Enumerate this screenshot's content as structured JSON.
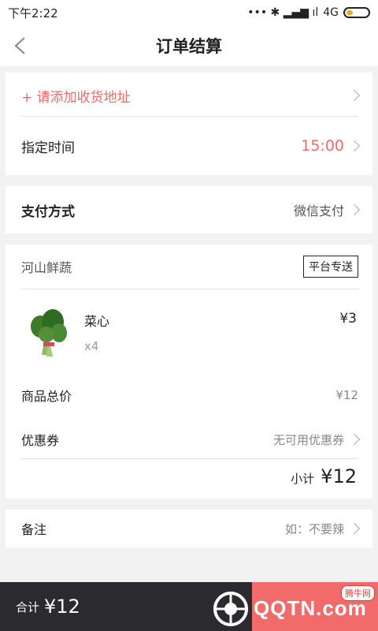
{
  "status_bar": {
    "time": "下午2:22",
    "signal_info": "... ✱ ᴴᴰ ıl ıl 4G",
    "network": "4G"
  },
  "nav": {
    "title": "订单结算"
  },
  "address": {
    "label": "+ 请添加收货地址"
  },
  "time_row": {
    "label": "指定时间",
    "value": "15:00"
  },
  "payment": {
    "label": "支付方式",
    "value": "微信支付"
  },
  "shop": {
    "name": "河山鲜蔬",
    "tag": "平台专送"
  },
  "product": {
    "name": "菜心",
    "qty": "x4",
    "price": "¥3"
  },
  "goods_total": {
    "label": "商品总价",
    "value": "¥12"
  },
  "coupon": {
    "label": "优惠券",
    "value": "无可用优惠券"
  },
  "subtotal": {
    "label": "小计",
    "amount": "¥12"
  },
  "remark": {
    "label": "备注",
    "placeholder": "如：不要辣"
  },
  "footer": {
    "total_label": "合计",
    "total_amount": "¥12"
  },
  "watermark": {
    "text": "QQTN.com",
    "badge": "腾牛网"
  },
  "colors": {
    "accent": "#f06a6a",
    "footer_bg": "#2b2b2f",
    "pay_bg": "#f26b6b"
  }
}
